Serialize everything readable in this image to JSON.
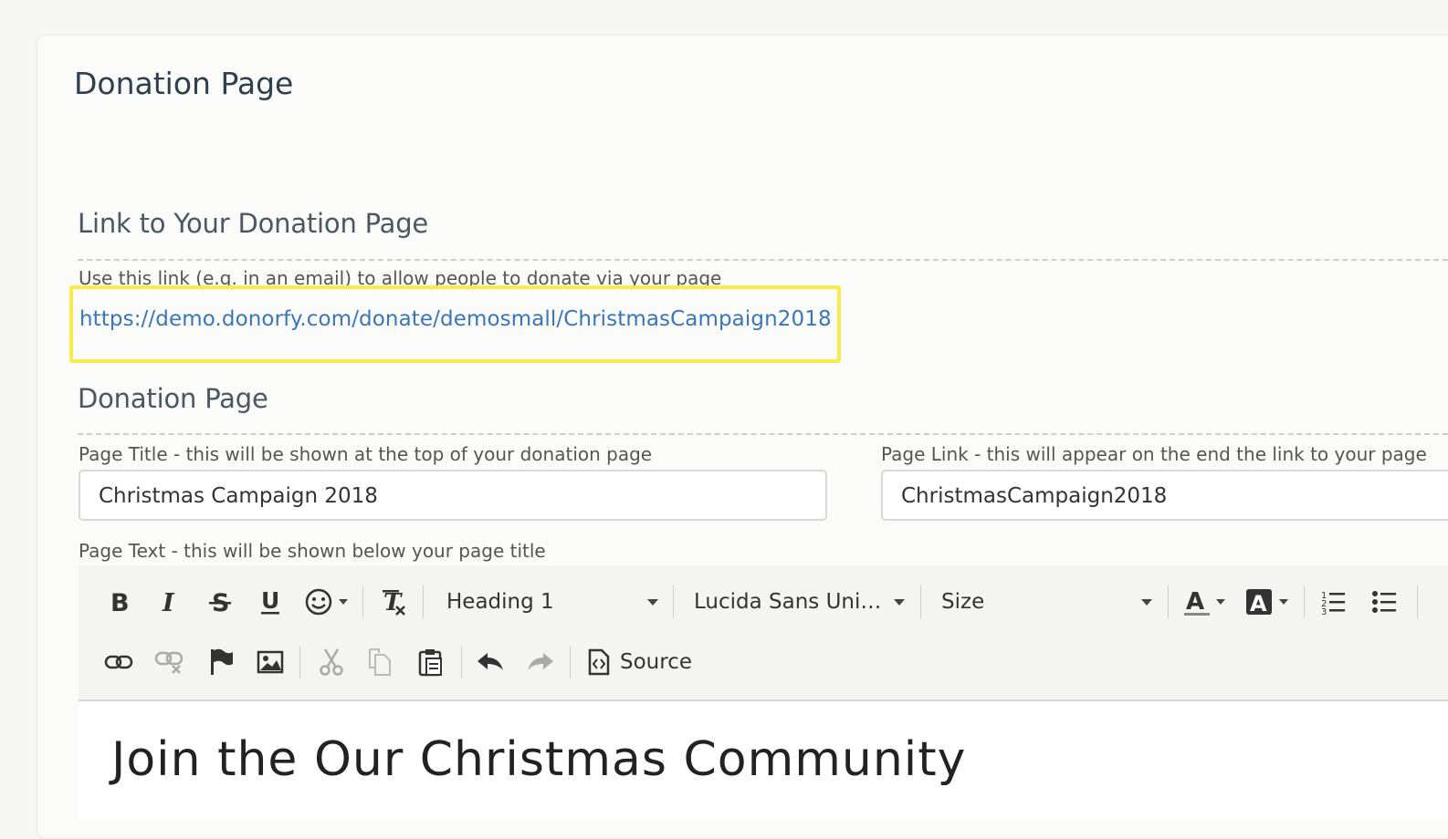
{
  "page": {
    "title": "Donation Page"
  },
  "link_section": {
    "title": "Link to Your Donation Page",
    "help": "Use this link (e.g. in an email) to allow people to donate via your page",
    "url": "https://demo.donorfy.com/donate/demosmall/ChristmasCampaign2018"
  },
  "donation_section": {
    "title": "Donation Page",
    "page_title_label": "Page Title - this will be shown at the top of your donation page",
    "page_title_value": "Christmas Campaign 2018",
    "page_link_label": "Page Link - this will appear on the end the link to your page",
    "page_link_value": "ChristmasCampaign2018",
    "page_text_label": "Page Text - this will be shown below your page title"
  },
  "editor": {
    "format_value": "Heading 1",
    "font_value": "Lucida Sans Uni…",
    "size_value": "Size",
    "source_label": "Source",
    "content_heading": "Join the Our Christmas Community"
  },
  "colors": {
    "link": "#3a77b8",
    "highlight": "#f7ec48"
  },
  "icons": [
    "bold-icon",
    "italic-icon",
    "strikethrough-icon",
    "underline-icon",
    "emoji-icon",
    "remove-format-icon",
    "font-color-icon",
    "background-color-icon",
    "numbered-list-icon",
    "bulleted-list-icon",
    "link-icon",
    "unlink-icon",
    "anchor-flag-icon",
    "image-icon",
    "cut-icon",
    "copy-icon",
    "paste-icon",
    "undo-icon",
    "redo-icon",
    "source-icon"
  ]
}
